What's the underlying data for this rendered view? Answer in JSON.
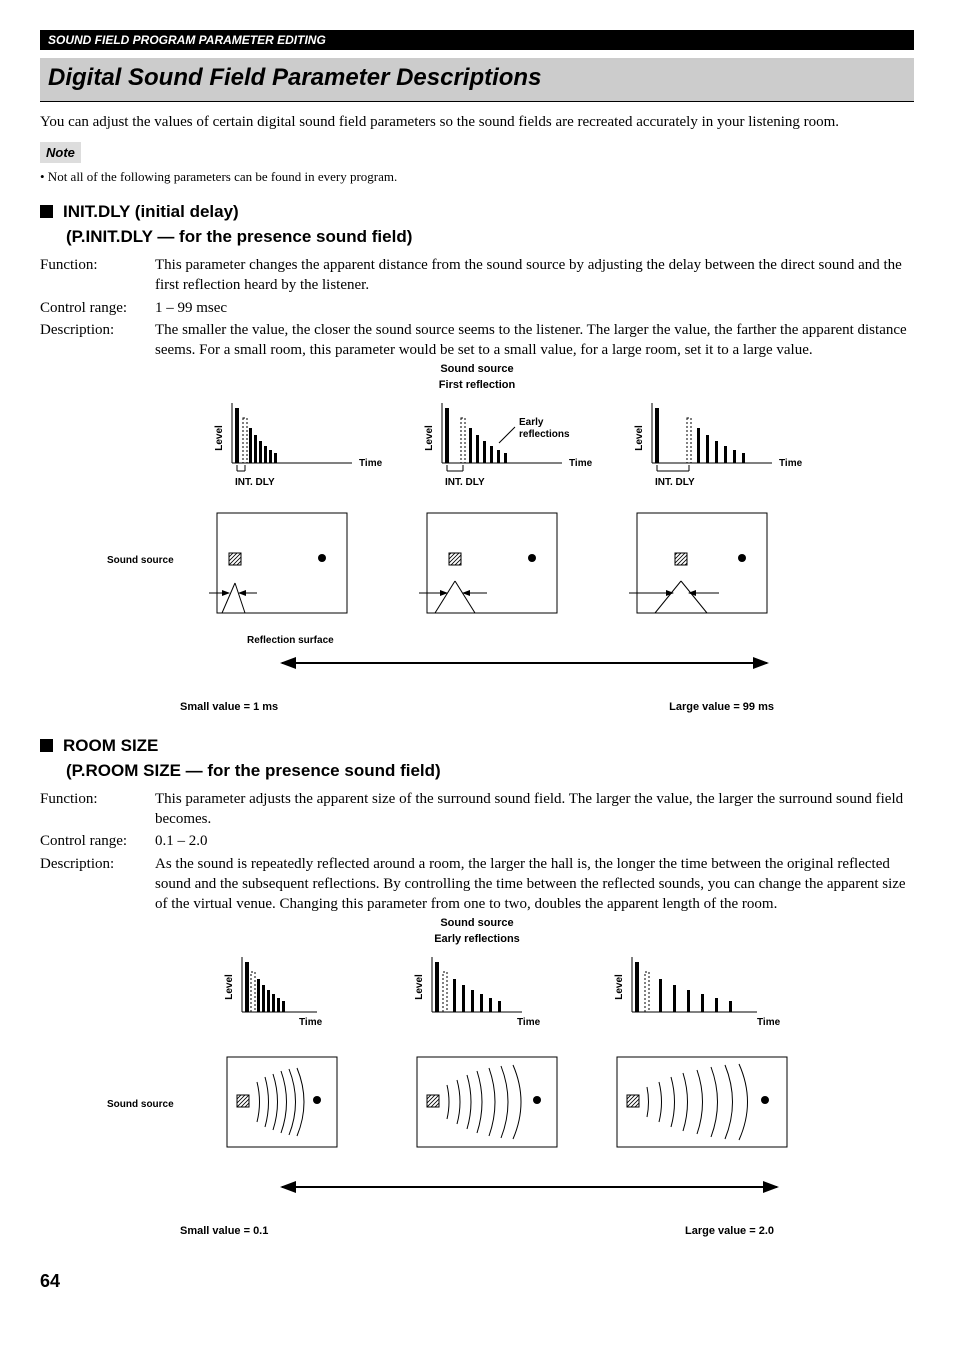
{
  "header_bar": "SOUND FIELD PROGRAM PARAMETER EDITING",
  "main_title": "Digital Sound Field Parameter Descriptions",
  "intro": "You can adjust the values of certain digital sound field parameters so the sound fields are recreated accurately in your listening room.",
  "note_label": "Note",
  "note_text": "• Not all of the following parameters can be found in every program.",
  "sections": [
    {
      "head": "INIT.DLY (initial delay)",
      "sub": "(P.INIT.DLY — for the presence sound field)",
      "function_label": "Function:",
      "function_text": "This parameter changes the apparent distance from the sound source by adjusting the delay between the direct sound and the first reflection heard by the listener.",
      "range_label": "Control range:",
      "range_text": "1 – 99 msec",
      "desc_label": "Description:",
      "desc_text": "The smaller the value, the closer the sound source seems to the listener. The larger the value, the farther the apparent distance seems. For a small room, this parameter would be set to a small value, for a large room, set it to a large value.",
      "diag": {
        "sound_source": "Sound source",
        "first_reflection": "First reflection",
        "early_reflections": "Early reflections",
        "level": "Level",
        "time": "Time",
        "int_dly": "INT. DLY",
        "reflection_surface": "Reflection surface",
        "small": "Small value = 1 ms",
        "large": "Large value = 99 ms"
      }
    },
    {
      "head": "ROOM SIZE",
      "sub": "(P.ROOM SIZE — for the presence sound field)",
      "function_label": "Function:",
      "function_text": "This parameter adjusts the apparent size of the surround sound field. The larger the value, the larger the surround sound field becomes.",
      "range_label": "Control range:",
      "range_text": "0.1 – 2.0",
      "desc_label": "Description:",
      "desc_text": "As the sound is repeatedly reflected around a room, the larger the hall is, the longer the time between the original reflected sound and the subsequent reflections. By controlling the time between the reflected sounds, you can change the apparent size of the virtual venue. Changing this parameter from one to two, doubles the apparent length of the room.",
      "diag": {
        "sound_source": "Sound source",
        "early_reflections": "Early reflections",
        "level": "Level",
        "time": "Time",
        "small": "Small value = 0.1",
        "large": "Large value = 2.0"
      }
    }
  ],
  "page_number": "64"
}
